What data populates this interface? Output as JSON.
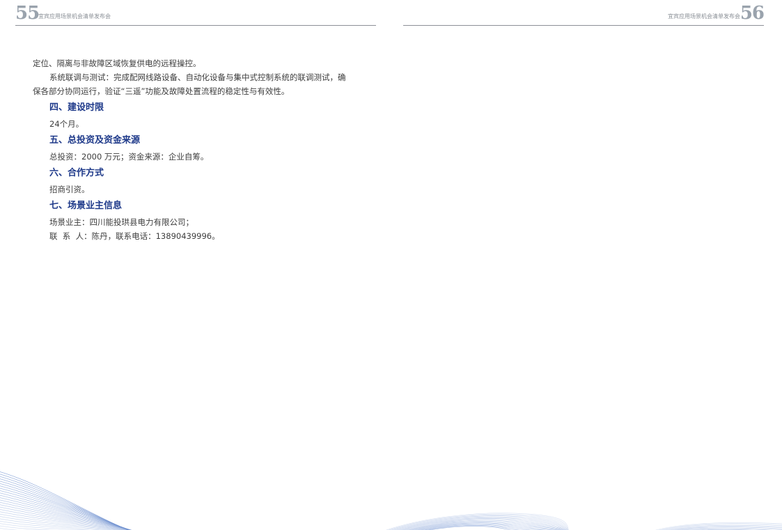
{
  "header": {
    "left_page_number": "55",
    "left_title": "宜宾应用场景机会清单发布会",
    "right_title": "宜宾应用场景机会清单发布会",
    "right_page_number": "56"
  },
  "body": {
    "para1": "定位、隔离与非故障区域恢复供电的远程操控。",
    "para2": "系统联调与测试：完成配网线路设备、自动化设备与集中式控制系统的联调测试，确保各部分协同运行，验证“三遥”功能及故障处置流程的稳定性与有效性。",
    "section4_title": "四、建设时限",
    "section4_text": "24个月。",
    "section5_title": "五、总投资及资金来源",
    "section5_text": "总投资：2000 万元；资金来源：企业自筹。",
    "section6_title": "六、合作方式",
    "section6_text": "招商引资。",
    "section7_title": "七、场景业主信息",
    "section7_owner": "场景业主：四川能投珙县电力有限公司；",
    "section7_contact": "联  系  人：陈丹，联系电话：13890439996。"
  },
  "colors": {
    "heading": "#1f3a8a",
    "wave": "#6d8fcf",
    "page_number": "#9aa3ad"
  }
}
